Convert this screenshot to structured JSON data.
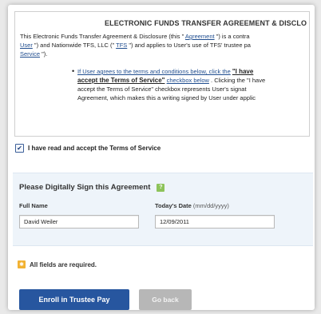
{
  "agreement": {
    "title": "ELECTRONIC FUNDS TRANSFER AGREEMENT & DISCLO",
    "para1_line1_a": "This Electronic Funds Transfer Agreement & Disclosure (this \" ",
    "para1_line1_link": "Agreement",
    "para1_line1_b": " \") is a contra",
    "para1_line2_link1": "User",
    "para1_line2_a": " \") and Nationwide TFS, LLC (\" ",
    "para1_line2_link2": "TFS",
    "para1_line2_b": " \") and applies to User's use of TFS' trustee pa",
    "para1_line3_link": "Service",
    "para1_line3_b": " \").",
    "bullet_line1_link": "If User agrees to the terms and conditions below, click the",
    "bullet_line1_strong": "\"I have",
    "bullet_line2_strong": "accept the Terms of Service\"",
    "bullet_line2_link": "checkbox below",
    "bullet_line2_b": " . Clicking the \"I have",
    "bullet_line3": "accept the Terms of Service\" checkbox represents User's signat",
    "bullet_line4": "Agreement, which makes this a writing signed by User under applic"
  },
  "agree_checkbox": {
    "checked": true,
    "check_glyph": "✔",
    "label": "I have read and accept the Terms of Service"
  },
  "sign_section": {
    "title": "Please Digitally Sign this Agreement",
    "help_glyph": "?",
    "full_name_label": "Full Name",
    "full_name_value": "David Weiler",
    "date_label": "Today's Date",
    "date_hint": "(mm/dd/yyyy)",
    "date_value": "12/09/2011"
  },
  "required_note": {
    "icon_glyph": "✱",
    "text": "All fields are required."
  },
  "buttons": {
    "enroll_label": "Enroll in Trustee Pay",
    "back_label": "Go back"
  },
  "colors": {
    "primary_button": "#27569f",
    "secondary_button": "#b7b7b7",
    "sign_panel": "#eef4fa",
    "help_icon": "#8dc35a",
    "required_icon": "#f2b233"
  }
}
